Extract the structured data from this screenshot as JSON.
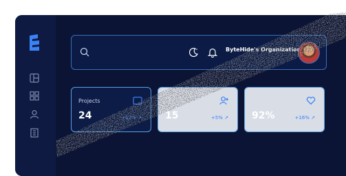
{
  "header": {
    "org_name": "ByteHide's Organization"
  },
  "icons": {
    "logo": "bytehide-logo-icon",
    "nav": [
      "dashboard-icon",
      "grid-icon",
      "user-icon",
      "building-icon"
    ],
    "search": "search-icon",
    "theme": "moon-icon",
    "notifications": "bell-icon"
  },
  "cards": [
    {
      "title": "Projects",
      "value": "24",
      "trend": "+12% ↗",
      "icon": "folder-icon"
    },
    {
      "title": "",
      "value": "15",
      "trend": "+5% ↗",
      "icon": "add-user-icon"
    },
    {
      "title": "",
      "value": "92%",
      "trend": "+16% ↗",
      "icon": "heart-icon"
    }
  ],
  "colors": {
    "background": "#0b1434",
    "accent": "#3b82f6",
    "border": "#5aa0e6"
  }
}
